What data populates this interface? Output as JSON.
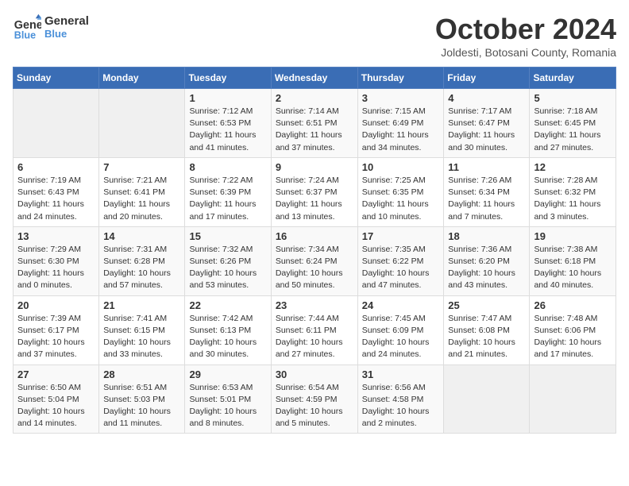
{
  "header": {
    "logo_line1": "General",
    "logo_line2": "Blue",
    "title": "October 2024",
    "subtitle": "Joldesti, Botosani County, Romania"
  },
  "weekdays": [
    "Sunday",
    "Monday",
    "Tuesday",
    "Wednesday",
    "Thursday",
    "Friday",
    "Saturday"
  ],
  "weeks": [
    [
      {
        "day": "",
        "info": ""
      },
      {
        "day": "",
        "info": ""
      },
      {
        "day": "1",
        "info": "Sunrise: 7:12 AM\nSunset: 6:53 PM\nDaylight: 11 hours and 41 minutes."
      },
      {
        "day": "2",
        "info": "Sunrise: 7:14 AM\nSunset: 6:51 PM\nDaylight: 11 hours and 37 minutes."
      },
      {
        "day": "3",
        "info": "Sunrise: 7:15 AM\nSunset: 6:49 PM\nDaylight: 11 hours and 34 minutes."
      },
      {
        "day": "4",
        "info": "Sunrise: 7:17 AM\nSunset: 6:47 PM\nDaylight: 11 hours and 30 minutes."
      },
      {
        "day": "5",
        "info": "Sunrise: 7:18 AM\nSunset: 6:45 PM\nDaylight: 11 hours and 27 minutes."
      }
    ],
    [
      {
        "day": "6",
        "info": "Sunrise: 7:19 AM\nSunset: 6:43 PM\nDaylight: 11 hours and 24 minutes."
      },
      {
        "day": "7",
        "info": "Sunrise: 7:21 AM\nSunset: 6:41 PM\nDaylight: 11 hours and 20 minutes."
      },
      {
        "day": "8",
        "info": "Sunrise: 7:22 AM\nSunset: 6:39 PM\nDaylight: 11 hours and 17 minutes."
      },
      {
        "day": "9",
        "info": "Sunrise: 7:24 AM\nSunset: 6:37 PM\nDaylight: 11 hours and 13 minutes."
      },
      {
        "day": "10",
        "info": "Sunrise: 7:25 AM\nSunset: 6:35 PM\nDaylight: 11 hours and 10 minutes."
      },
      {
        "day": "11",
        "info": "Sunrise: 7:26 AM\nSunset: 6:34 PM\nDaylight: 11 hours and 7 minutes."
      },
      {
        "day": "12",
        "info": "Sunrise: 7:28 AM\nSunset: 6:32 PM\nDaylight: 11 hours and 3 minutes."
      }
    ],
    [
      {
        "day": "13",
        "info": "Sunrise: 7:29 AM\nSunset: 6:30 PM\nDaylight: 11 hours and 0 minutes."
      },
      {
        "day": "14",
        "info": "Sunrise: 7:31 AM\nSunset: 6:28 PM\nDaylight: 10 hours and 57 minutes."
      },
      {
        "day": "15",
        "info": "Sunrise: 7:32 AM\nSunset: 6:26 PM\nDaylight: 10 hours and 53 minutes."
      },
      {
        "day": "16",
        "info": "Sunrise: 7:34 AM\nSunset: 6:24 PM\nDaylight: 10 hours and 50 minutes."
      },
      {
        "day": "17",
        "info": "Sunrise: 7:35 AM\nSunset: 6:22 PM\nDaylight: 10 hours and 47 minutes."
      },
      {
        "day": "18",
        "info": "Sunrise: 7:36 AM\nSunset: 6:20 PM\nDaylight: 10 hours and 43 minutes."
      },
      {
        "day": "19",
        "info": "Sunrise: 7:38 AM\nSunset: 6:18 PM\nDaylight: 10 hours and 40 minutes."
      }
    ],
    [
      {
        "day": "20",
        "info": "Sunrise: 7:39 AM\nSunset: 6:17 PM\nDaylight: 10 hours and 37 minutes."
      },
      {
        "day": "21",
        "info": "Sunrise: 7:41 AM\nSunset: 6:15 PM\nDaylight: 10 hours and 33 minutes."
      },
      {
        "day": "22",
        "info": "Sunrise: 7:42 AM\nSunset: 6:13 PM\nDaylight: 10 hours and 30 minutes."
      },
      {
        "day": "23",
        "info": "Sunrise: 7:44 AM\nSunset: 6:11 PM\nDaylight: 10 hours and 27 minutes."
      },
      {
        "day": "24",
        "info": "Sunrise: 7:45 AM\nSunset: 6:09 PM\nDaylight: 10 hours and 24 minutes."
      },
      {
        "day": "25",
        "info": "Sunrise: 7:47 AM\nSunset: 6:08 PM\nDaylight: 10 hours and 21 minutes."
      },
      {
        "day": "26",
        "info": "Sunrise: 7:48 AM\nSunset: 6:06 PM\nDaylight: 10 hours and 17 minutes."
      }
    ],
    [
      {
        "day": "27",
        "info": "Sunrise: 6:50 AM\nSunset: 5:04 PM\nDaylight: 10 hours and 14 minutes."
      },
      {
        "day": "28",
        "info": "Sunrise: 6:51 AM\nSunset: 5:03 PM\nDaylight: 10 hours and 11 minutes."
      },
      {
        "day": "29",
        "info": "Sunrise: 6:53 AM\nSunset: 5:01 PM\nDaylight: 10 hours and 8 minutes."
      },
      {
        "day": "30",
        "info": "Sunrise: 6:54 AM\nSunset: 4:59 PM\nDaylight: 10 hours and 5 minutes."
      },
      {
        "day": "31",
        "info": "Sunrise: 6:56 AM\nSunset: 4:58 PM\nDaylight: 10 hours and 2 minutes."
      },
      {
        "day": "",
        "info": ""
      },
      {
        "day": "",
        "info": ""
      }
    ]
  ]
}
